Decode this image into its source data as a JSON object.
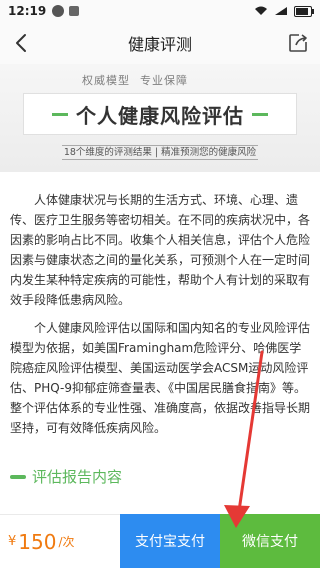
{
  "status": {
    "time": "12:19"
  },
  "nav": {
    "title": "健康评测"
  },
  "banner": {
    "tag_left": "权威模型",
    "tag_right": "专业保障",
    "headline": "个人健康风险评估",
    "sub": "18个维度的评测结果 | 精准预测您的健康风险"
  },
  "content": {
    "p1": "人体健康状况与长期的生活方式、环境、心理、遗传、医疗卫生服务等密切相关。在不同的疾病状况中，各因素的影响占比不同。收集个人相关信息，评估个人危险因素与健康状态之间的量化关系，可预测个人在一定时间内发生某种特定疾病的可能性，帮助个人有计划的采取有效手段降低患病风险。",
    "p2": "个人健康风险评估以国际和国内知名的专业风险评估模型为依据，如美国Framingham危险评分、哈佛医学院癌症风险评估模型、美国运动医学会ACSM运动风险评估、PHQ-9抑郁症筛查量表、《中国居民膳食指南》等。整个评估体系的专业性强、准确度高，依据改善指导长期坚持，可有效降低疾病风险。"
  },
  "section": {
    "title": "评估报告内容"
  },
  "bottom": {
    "currency": "¥",
    "price": "150",
    "unit": "/次",
    "alipay_label": "支付宝支付",
    "wechat_label": "微信支付"
  },
  "colors": {
    "accent": "#5cb85c",
    "alipay": "#2d8cf0",
    "wechat": "#5dbb3e",
    "price": "#f07a10",
    "arrow": "#e53935"
  }
}
